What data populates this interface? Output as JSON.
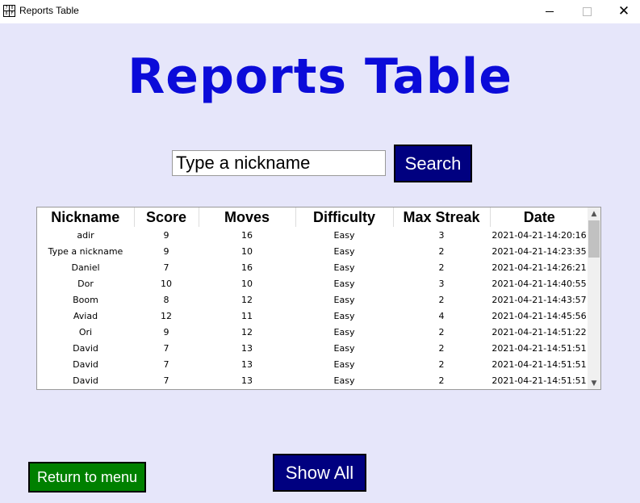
{
  "window": {
    "title": "Reports Table",
    "icon_text": [
      "7",
      "0",
      "8",
      "F"
    ],
    "minimize_icon": "minimize-icon",
    "maximize_icon": "maximize-icon",
    "close_glyph": "✕"
  },
  "heading": "Reports Table",
  "search": {
    "value": "Type a nickname",
    "button_label": "Search"
  },
  "table": {
    "columns": [
      "Nickname",
      "Score",
      "Moves",
      "Difficulty",
      "Max Streak",
      "Date"
    ],
    "rows": [
      [
        "adir",
        "9",
        "16",
        "Easy",
        "3",
        "2021-04-21-14:20:16"
      ],
      [
        "Type a nickname",
        "9",
        "10",
        "Easy",
        "2",
        "2021-04-21-14:23:35"
      ],
      [
        "Daniel",
        "7",
        "16",
        "Easy",
        "2",
        "2021-04-21-14:26:21"
      ],
      [
        "Dor",
        "10",
        "10",
        "Easy",
        "3",
        "2021-04-21-14:40:55"
      ],
      [
        "Boom",
        "8",
        "12",
        "Easy",
        "2",
        "2021-04-21-14:43:57"
      ],
      [
        "Aviad",
        "12",
        "11",
        "Easy",
        "4",
        "2021-04-21-14:45:56"
      ],
      [
        "Ori",
        "9",
        "12",
        "Easy",
        "2",
        "2021-04-21-14:51:22"
      ],
      [
        "David",
        "7",
        "13",
        "Easy",
        "2",
        "2021-04-21-14:51:51"
      ],
      [
        "David",
        "7",
        "13",
        "Easy",
        "2",
        "2021-04-21-14:51:51"
      ],
      [
        "David",
        "7",
        "13",
        "Easy",
        "2",
        "2021-04-21-14:51:51"
      ]
    ],
    "scroll_up_glyph": "▲",
    "scroll_down_glyph": "▼"
  },
  "buttons": {
    "show_all": "Show All",
    "return_to_menu": "Return to menu"
  },
  "colors": {
    "background": "#e6e6fa",
    "heading": "#0b0bd9",
    "navy_button": "#000080",
    "green_button": "#008000"
  }
}
